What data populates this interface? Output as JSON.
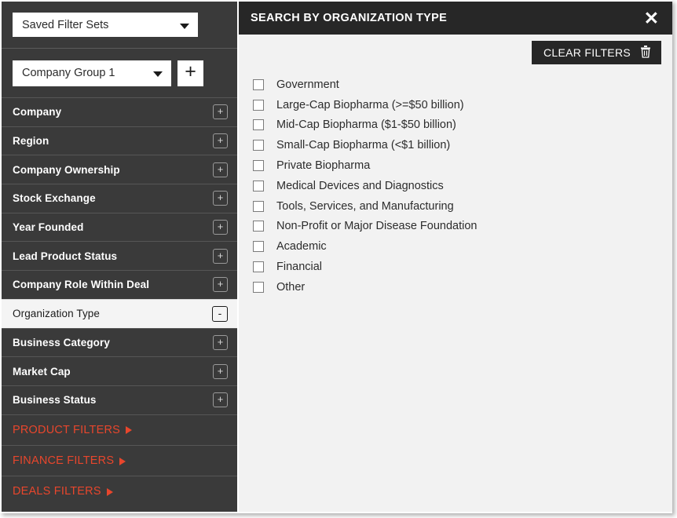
{
  "sidebar": {
    "saved_filter_sets": {
      "value": "Saved Filter Sets",
      "icon": "chevron-down-icon"
    },
    "company_group": {
      "value": "Company Group 1",
      "icon": "chevron-down-icon",
      "add_label": "+"
    },
    "filters": [
      {
        "label": "Company",
        "toggle": "+",
        "active": false
      },
      {
        "label": "Region",
        "toggle": "+",
        "active": false
      },
      {
        "label": "Company Ownership",
        "toggle": "+",
        "active": false
      },
      {
        "label": "Stock Exchange",
        "toggle": "+",
        "active": false
      },
      {
        "label": "Year Founded",
        "toggle": "+",
        "active": false
      },
      {
        "label": "Lead Product Status",
        "toggle": "+",
        "active": false
      },
      {
        "label": "Company Role Within Deal",
        "toggle": "+",
        "active": false
      },
      {
        "label": "Organization Type",
        "toggle": "-",
        "active": true
      },
      {
        "label": "Business Category",
        "toggle": "+",
        "active": false
      },
      {
        "label": "Market Cap",
        "toggle": "+",
        "active": false
      },
      {
        "label": "Business Status",
        "toggle": "+",
        "active": false
      }
    ],
    "sections": [
      {
        "label": "PRODUCT FILTERS",
        "icon": "arrow-right-icon"
      },
      {
        "label": "FINANCE FILTERS",
        "icon": "arrow-right-icon"
      },
      {
        "label": "DEALS FILTERS",
        "icon": "arrow-right-icon"
      }
    ]
  },
  "panel": {
    "title": "SEARCH BY ORGANIZATION TYPE",
    "close_label": "✕",
    "clear_filters_label": "CLEAR FILTERS",
    "clear_filters_icon": "trash-icon",
    "options": [
      {
        "label": "Government",
        "checked": false
      },
      {
        "label": "Large-Cap Biopharma (>=$50 billion)",
        "checked": false
      },
      {
        "label": "Mid-Cap Biopharma ($1-$50 billion)",
        "checked": false
      },
      {
        "label": "Small-Cap Biopharma (<$1 billion)",
        "checked": false
      },
      {
        "label": "Private Biopharma",
        "checked": false
      },
      {
        "label": "Medical Devices and Diagnostics",
        "checked": false
      },
      {
        "label": "Tools, Services, and Manufacturing",
        "checked": false
      },
      {
        "label": "Non-Profit or Major Disease Foundation",
        "checked": false
      },
      {
        "label": "Academic",
        "checked": false
      },
      {
        "label": "Financial",
        "checked": false
      },
      {
        "label": "Other",
        "checked": false
      }
    ]
  },
  "colors": {
    "sidebar_bg": "#3a3a3a",
    "panel_header_bg": "#272727",
    "panel_bg": "#f2f2f2",
    "accent_red": "#e8462c",
    "active_row_bg": "#f4f4f4"
  }
}
